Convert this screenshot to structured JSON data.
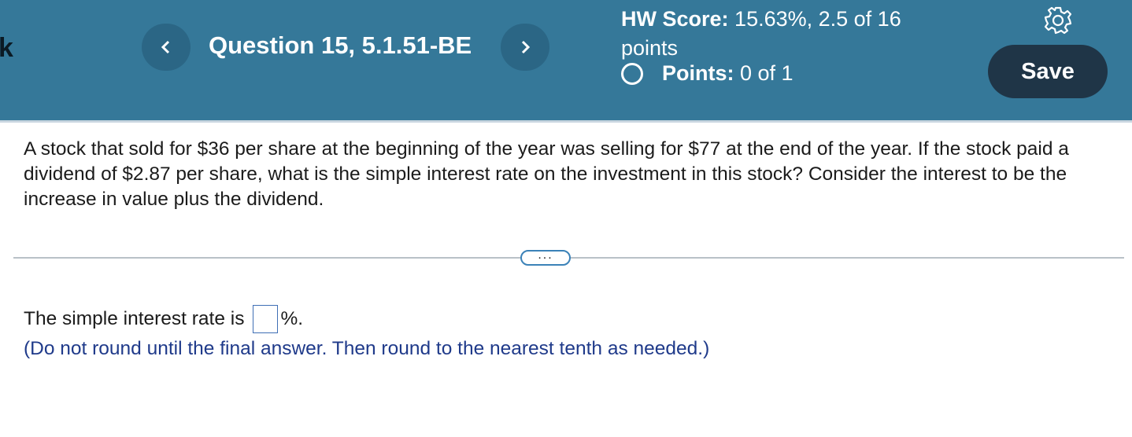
{
  "header": {
    "back_glyph": "k",
    "question_title": "Question 15, 5.1.51-BE",
    "hw_score_label": "HW Score:",
    "hw_score_value": "15.63%, 2.5 of 16",
    "hw_score_suffix": "points",
    "points_label": "Points:",
    "points_value": "0 of 1",
    "save_label": "Save"
  },
  "question": {
    "text": "A stock that sold for $36 per share at the beginning of the year was selling for $77 at the end of the year. If the stock paid a dividend of $2.87 per share, what is the simple interest rate on the investment in this stock? Consider the interest to be the increase in value plus the dividend."
  },
  "divider": {
    "more_label": "..."
  },
  "answer": {
    "prefix": "The simple interest rate is",
    "value": "",
    "suffix": "%.",
    "instruction": "(Do not round until the final answer. Then round to the nearest tenth as needed.)"
  },
  "colors": {
    "header_bg": "#357899",
    "nav_button_bg": "#2b6685",
    "save_button_bg": "#1f3547",
    "instruction_text": "#1f3a8a",
    "answer_box_border": "#3f6fb5"
  },
  "icons": {
    "prev": "chevron-left-icon",
    "next": "chevron-right-icon",
    "settings": "gear-icon",
    "status": "empty-circle-icon"
  }
}
